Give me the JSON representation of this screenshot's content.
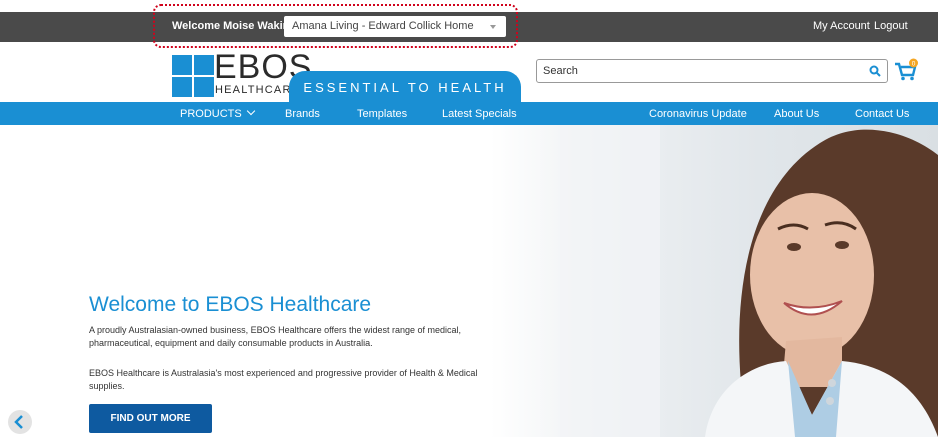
{
  "topbar": {
    "welcome": "Welcome Moise Wakim",
    "facility": "Amana Living - Edward Collick Home",
    "my_account": "My Account",
    "logout": "Logout"
  },
  "logo": {
    "word": "EBOS",
    "sub": "HEALTHCARE",
    "tagline": "ESSENTIAL TO HEALTH"
  },
  "search": {
    "placeholder": "Search"
  },
  "cart": {
    "count": "0"
  },
  "nav": {
    "products": "PRODUCTS",
    "brands": "Brands",
    "templates": "Templates",
    "latest_specials": "Latest Specials",
    "coronavirus": "Coronavirus Update",
    "about": "About Us",
    "contact": "Contact Us"
  },
  "hero": {
    "title": "Welcome to EBOS Healthcare",
    "paragraph1": "A proudly Australasian-owned business, EBOS Healthcare offers the widest range of medical, pharmaceutical, equipment and daily consumable products in Australia.",
    "paragraph2": "EBOS Healthcare is Australasia's most experienced and progressive provider of Health & Medical supplies.",
    "cta": "FIND OUT MORE"
  },
  "colors": {
    "brand_blue": "#1a8fd3",
    "cta_blue": "#0e5aa0",
    "topbar": "#4a4a4a",
    "highlight": "#d0021b"
  },
  "icons": [
    "chevron-down-icon",
    "search-icon",
    "cart-icon",
    "chevron-left-icon"
  ]
}
